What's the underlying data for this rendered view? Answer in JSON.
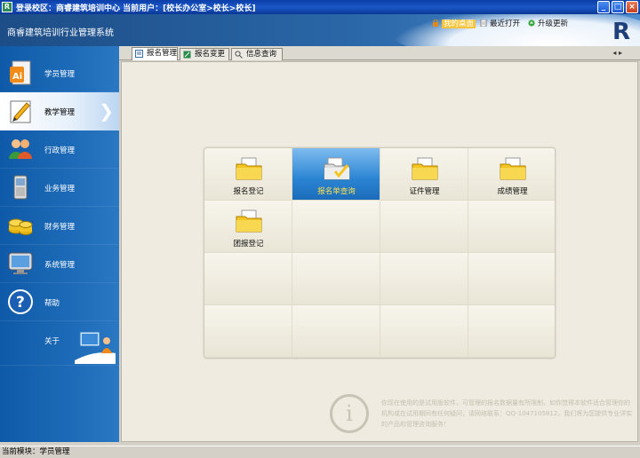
{
  "window": {
    "title": "登录校区：商睿建筑培训中心    当前用户：[校长办公室>校长>校长]",
    "buttons": [
      "_",
      "□",
      "×"
    ]
  },
  "header": {
    "system_name": "商睿建筑培训行业管理系统",
    "logo_letter": "R",
    "tools": [
      {
        "label": "我的桌面",
        "icon": "lock-icon",
        "active": true
      },
      {
        "label": "最近打开",
        "icon": "document-icon",
        "active": false
      },
      {
        "label": "升级更新",
        "icon": "update-icon",
        "active": false
      }
    ]
  },
  "sidebar": {
    "items": [
      {
        "label": "学员管理",
        "icon": "student-file-icon"
      },
      {
        "label": "教学管理",
        "icon": "pencil-notebook-icon",
        "active": true,
        "arrow": "❯"
      },
      {
        "label": "行政管理",
        "icon": "people-icon"
      },
      {
        "label": "业务管理",
        "icon": "phone-icon"
      },
      {
        "label": "财务管理",
        "icon": "coins-icon"
      },
      {
        "label": "系统管理",
        "icon": "monitor-icon"
      },
      {
        "label": "帮助",
        "icon": "help-icon"
      },
      {
        "label": "关于",
        "icon": "about-computer-icon"
      }
    ]
  },
  "tabs": [
    {
      "label": "报名管理",
      "active": true
    },
    {
      "label": "报名变更",
      "active": false
    },
    {
      "label": "信息查询",
      "active": false
    }
  ],
  "tab_nav": "◂ ▸",
  "grid": {
    "items": [
      {
        "label": "报名登记",
        "selected": false
      },
      {
        "label": "报名单查询",
        "selected": true
      },
      {
        "label": "证件管理",
        "selected": false
      },
      {
        "label": "成绩管理",
        "selected": false
      },
      {
        "label": "团报登记",
        "selected": false
      }
    ]
  },
  "notice": "你现在使用的是试用版软件，可管理的报名数据量有所限制，如你觉得本软件适合管理你的机构或在试用期间有任何疑问，请网络联系：QQ-1047105812，我们将为您提供专业详实的产品和管理咨询服务！",
  "info_glyph": "i",
  "status": "当前模块：学员管理",
  "colors": {
    "accent": "#1d6bb8",
    "selected_cell": "#2a84d2",
    "selected_label": "#ffe14a"
  }
}
